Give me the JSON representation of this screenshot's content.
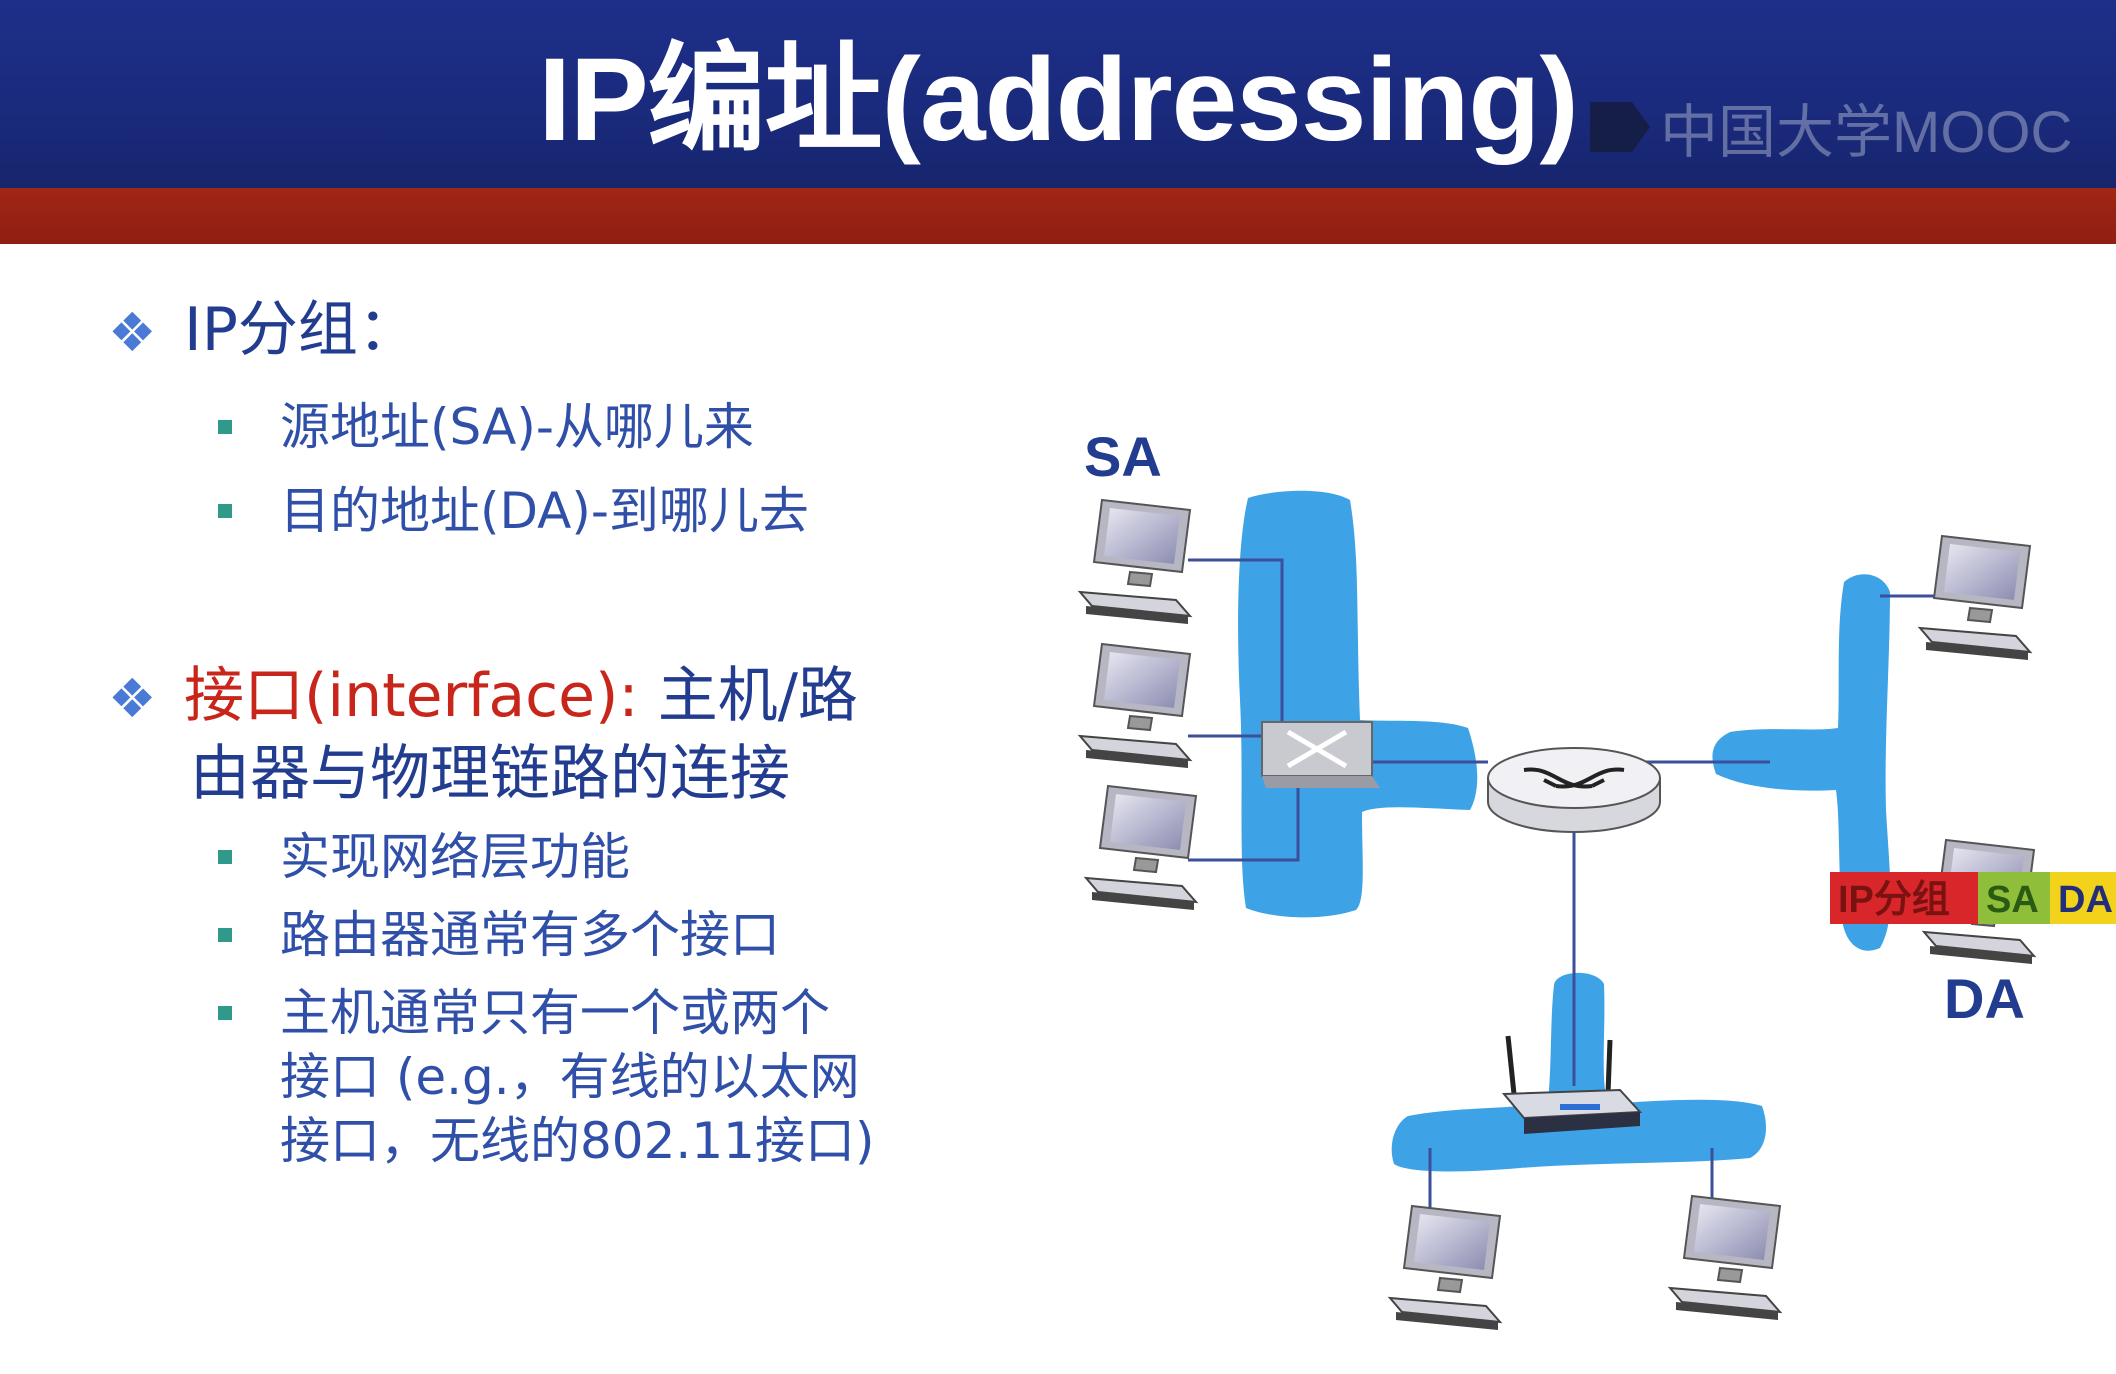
{
  "header": {
    "title": "IP编址(addressing)",
    "watermark": "中国大学MOOC"
  },
  "bullets": {
    "b1": "IP分组：",
    "b1_items": [
      "源地址(SA)-从哪儿来",
      "目的地址(DA)-到哪儿去"
    ],
    "b2_red": "接口(interface):",
    "b2_rest": " 主机/路",
    "b2_line2": "由器与物理链路的连接",
    "b2_items": [
      "实现网络层功能",
      "路由器通常有多个接口"
    ],
    "b2_item3": [
      "主机通常只有一个或两个",
      "接口 (e.g.，有线的以太网",
      "接口，无线的802.11接口)"
    ]
  },
  "diagram": {
    "sa_label": "SA",
    "da_label": "DA",
    "packet": [
      "IP分组",
      "SA",
      "DA"
    ],
    "colors": {
      "network_blob": "#3ea3e6",
      "packet_ip": "#d8262a",
      "packet_sa": "#8fbf3a",
      "packet_da": "#f2d21a",
      "label": "#223c8f"
    }
  }
}
